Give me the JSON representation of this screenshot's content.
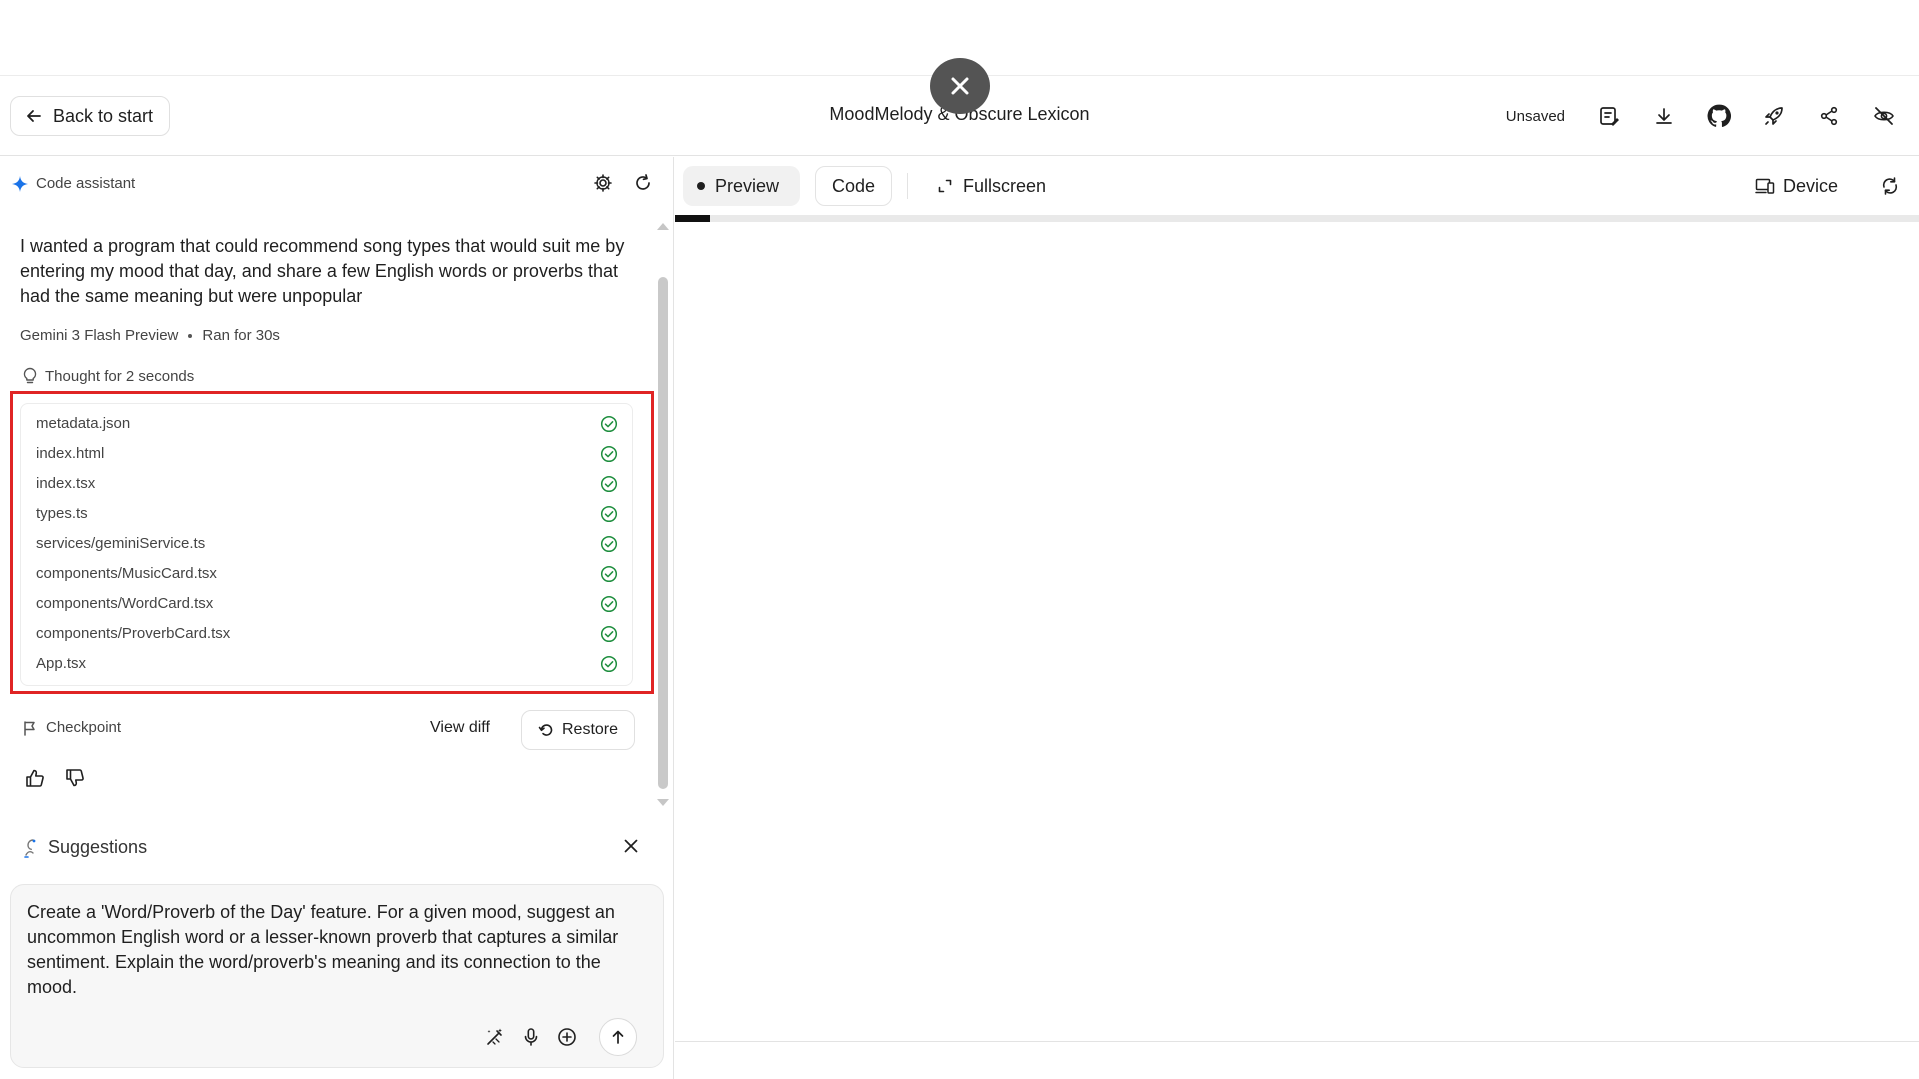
{
  "header": {
    "back_label": "Back to start",
    "title": "MoodMelody & Obscure Lexicon",
    "status": "Unsaved"
  },
  "assistant": {
    "title": "Code assistant",
    "prompt": "I wanted a program that could recommend song types that would suit me by entering my mood that day, and share a few English words or proverbs that had the same meaning but were unpopular",
    "model": "Gemini 3 Flash Preview",
    "run_time": "Ran for 30s",
    "thought": "Thought for 2 seconds",
    "files": [
      {
        "name": "metadata.json"
      },
      {
        "name": "index.html"
      },
      {
        "name": "index.tsx"
      },
      {
        "name": "types.ts"
      },
      {
        "name": "services/geminiService.ts"
      },
      {
        "name": "components/MusicCard.tsx"
      },
      {
        "name": "components/WordCard.tsx"
      },
      {
        "name": "components/ProverbCard.tsx"
      },
      {
        "name": "App.tsx"
      }
    ],
    "checkpoint_label": "Checkpoint",
    "view_diff_label": "View diff",
    "restore_label": "Restore"
  },
  "suggestions": {
    "title": "Suggestions",
    "text": "Create a 'Word/Proverb of the Day' feature. For a given mood, suggest an uncommon English word or a lesser-known proverb that captures a similar sentiment. Explain the word/proverb's meaning and its connection to the mood."
  },
  "preview": {
    "tabs": {
      "preview": "Preview",
      "code": "Code",
      "fullscreen": "Fullscreen"
    },
    "device_label": "Device",
    "loading_progress": 0.028
  },
  "colors": {
    "accent": "#1a73e8",
    "success": "#1e8e3e",
    "highlight": "#e02424"
  }
}
